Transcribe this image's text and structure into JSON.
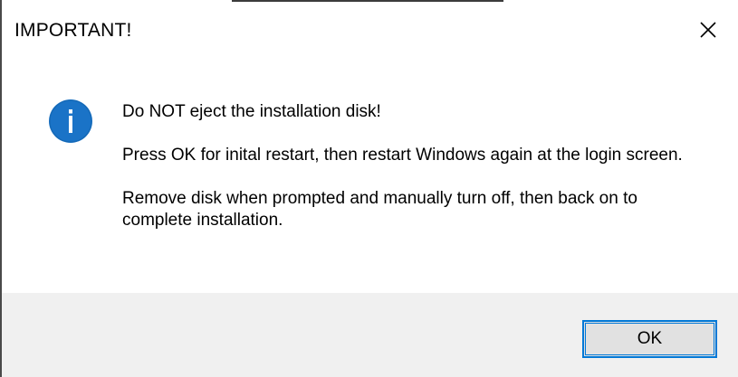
{
  "dialog": {
    "title": "IMPORTANT!",
    "icon": "info-icon",
    "accent_color": "#0078d7",
    "icon_color": "#1a73c7",
    "messages": {
      "line1": "Do NOT eject the installation disk!",
      "line2": "Press OK for inital restart, then restart Windows again at the login screen.",
      "line3": "Remove disk when prompted and manually turn off, then back on to complete installation."
    },
    "buttons": {
      "ok_label": "OK",
      "close_icon": "close-icon"
    }
  }
}
